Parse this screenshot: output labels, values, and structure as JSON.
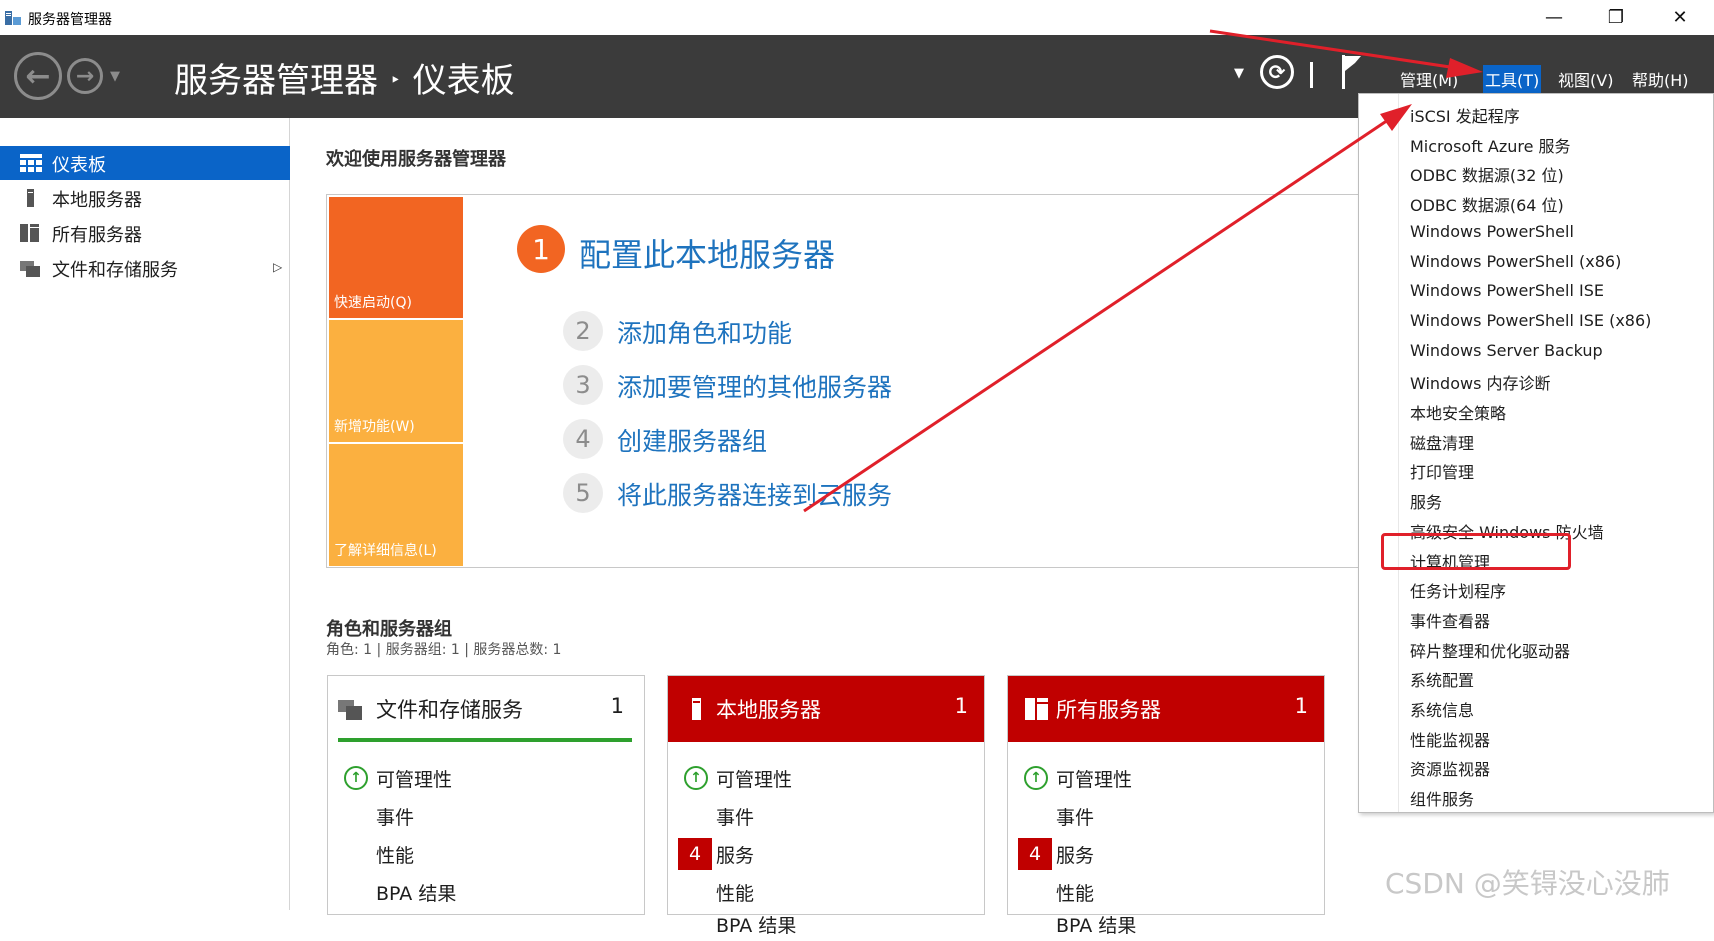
{
  "window": {
    "title": "服务器管理器",
    "controls": [
      "—",
      "❐",
      "✕"
    ]
  },
  "header": {
    "breadcrumb_root": "服务器管理器",
    "breadcrumb_sep": "‣",
    "breadcrumb_current": "仪表板",
    "menus": [
      "管理(M)",
      "工具(T)",
      "视图(V)",
      "帮助(H)"
    ],
    "active_menu": "工具(T)"
  },
  "sidebar": {
    "items": [
      {
        "label": "仪表板",
        "icon": "dashboard-icon",
        "active": true
      },
      {
        "label": "本地服务器",
        "icon": "server-icon"
      },
      {
        "label": "所有服务器",
        "icon": "servers-icon"
      },
      {
        "label": "文件和存储服务",
        "icon": "storage-icon",
        "expandable": true
      }
    ]
  },
  "welcome": {
    "title": "欢迎使用服务器管理器",
    "tiles": [
      "快速启动(Q)",
      "新增功能(W)",
      "了解详细信息(L)"
    ],
    "main_step": {
      "num": "1",
      "label": "配置此本地服务器"
    },
    "steps": [
      {
        "num": "2",
        "label": "添加角色和功能"
      },
      {
        "num": "3",
        "label": "添加要管理的其他服务器"
      },
      {
        "num": "4",
        "label": "创建服务器组"
      },
      {
        "num": "5",
        "label": "将此服务器连接到云服务"
      }
    ]
  },
  "roles": {
    "title": "角色和服务器组",
    "subtitle": "角色: 1 | 服务器组: 1 | 服务器总数: 1",
    "cards": [
      {
        "title": "文件和存储服务",
        "count": "1",
        "rows": [
          "可管理性",
          "事件",
          "性能",
          "BPA 结果"
        ]
      },
      {
        "title": "本地服务器",
        "count": "1",
        "rows": [
          "可管理性",
          "事件",
          "服务",
          "性能",
          "BPA 结果"
        ],
        "badge": "4"
      },
      {
        "title": "所有服务器",
        "count": "1",
        "rows": [
          "可管理性",
          "事件",
          "服务",
          "性能",
          "BPA 结果"
        ],
        "badge": "4"
      }
    ]
  },
  "tools_menu": {
    "items": [
      "iSCSI 发起程序",
      "Microsoft Azure 服务",
      "ODBC 数据源(32 位)",
      "ODBC 数据源(64 位)",
      "Windows PowerShell",
      "Windows PowerShell (x86)",
      "Windows PowerShell ISE",
      "Windows PowerShell ISE (x86)",
      "Windows Server Backup",
      "Windows 内存诊断",
      "本地安全策略",
      "磁盘清理",
      "打印管理",
      "服务",
      "高级安全 Windows 防火墙",
      "计算机管理",
      "任务计划程序",
      "事件查看器",
      "碎片整理和优化驱动器",
      "系统配置",
      "系统信息",
      "性能监视器",
      "资源监视器",
      "组件服务"
    ],
    "highlighted": "计算机管理"
  },
  "colors": {
    "header_bg": "#3b3b3b",
    "accent_blue": "#0a64c8",
    "link_blue": "#1e73be",
    "quick_orange": "#f26522",
    "tile_yellow": "#fbb040",
    "alert_red": "#c00000",
    "ok_green": "#2ea02e",
    "annotation_red": "#e0202a"
  },
  "watermark": "CSDN @笑锝没心没肺"
}
